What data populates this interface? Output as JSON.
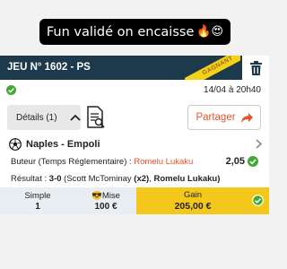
{
  "caption": {
    "text": "Fun validé on encaisse",
    "emojis": "🔥😍"
  },
  "ticket": {
    "game_title": "JEU N° 1602 - PS",
    "ribbon": "GAGNANT",
    "date": "14/04 à 20h40",
    "details_label": "Détails (1)",
    "share_label": "Partager"
  },
  "match": {
    "teams": "Naples - Empoli",
    "bet_label": "Buteur (Temps Réglementaire) : ",
    "bet_pick": "Romelu Lukaku",
    "odds": "2,05",
    "result_prefix": "Résultat : ",
    "result_score": "3-0",
    "result_mid": " (Scott McTominay ",
    "result_x2": "(x2)",
    "result_sep": ", ",
    "result_last": "Romelu Lukaku)"
  },
  "summary": {
    "type_label": "Simple",
    "type_value": "1",
    "stake_label": "😎Mise",
    "stake_value": "100 €",
    "gain_label": "Gain",
    "gain_value": "205,00 €"
  },
  "colors": {
    "header": "#1d3a4d",
    "accent": "#e8542a",
    "gain": "#f3c81b",
    "check": "#44a837"
  },
  "icons": [
    "trash-icon",
    "check-icon",
    "chevron-up-icon",
    "document-icon",
    "share-arrow-icon",
    "soccer-ball-icon",
    "chevron-right-icon"
  ]
}
